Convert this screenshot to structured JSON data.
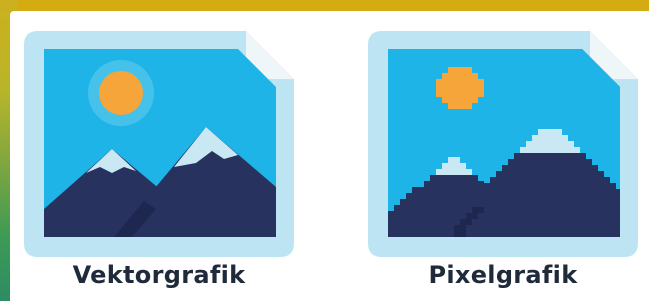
{
  "tiles": [
    {
      "label": "Vektorgrafik",
      "icon": "vector-image-file-icon"
    },
    {
      "label": "Pixelgrafik",
      "icon": "pixel-image-file-icon"
    }
  ],
  "colors": {
    "background_gold": "#d4ac12",
    "frame": "#bde4f3",
    "sky": "#1fb4e8",
    "sun": "#f5a53a",
    "mountain": "#27325f",
    "snow": "#c9e8f4",
    "fold": "#eef6fa"
  }
}
